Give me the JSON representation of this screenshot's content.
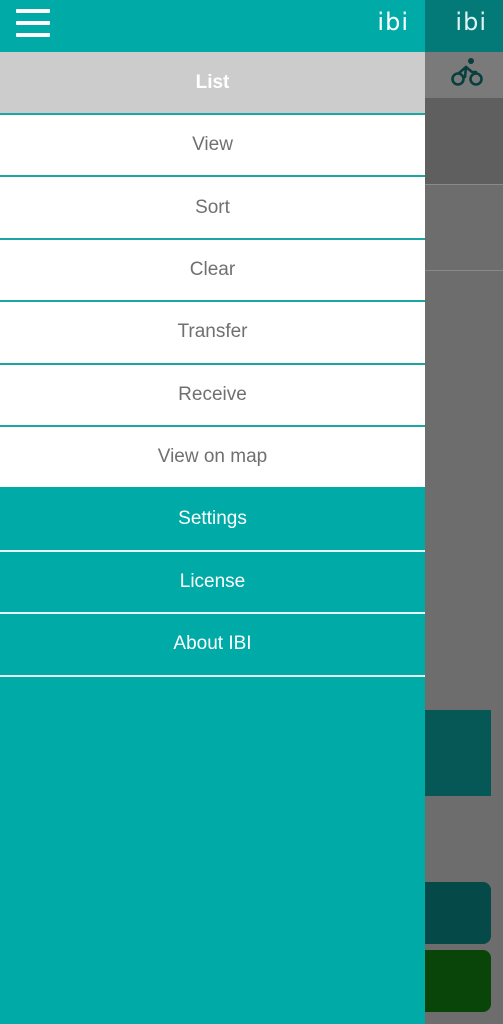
{
  "app": {
    "logo_text": "ibi",
    "colors": {
      "teal": "#00aba7",
      "dark_teal": "#037a78",
      "header_gray": "#cccccc",
      "item_text": "#707070",
      "white": "#ffffff"
    }
  },
  "drawer": {
    "menu_icon": "hamburger-icon",
    "section_title": "List",
    "list_items": [
      {
        "label": "View"
      },
      {
        "label": "Sort"
      },
      {
        "label": "Clear"
      },
      {
        "label": "Transfer"
      },
      {
        "label": "Receive"
      },
      {
        "label": "View on map"
      }
    ],
    "app_items": [
      {
        "label": "Settings"
      },
      {
        "label": "License"
      },
      {
        "label": "About IBI"
      }
    ]
  },
  "background": {
    "toolbar_icon": "bicycle-icon"
  }
}
